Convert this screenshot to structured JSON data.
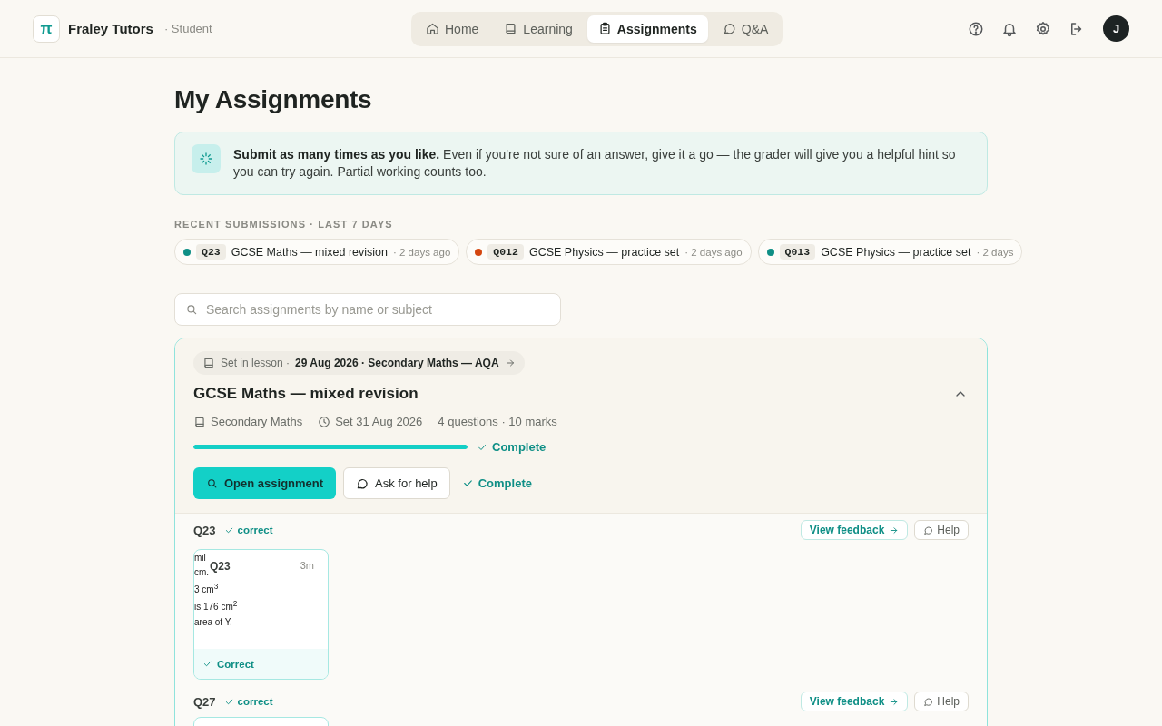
{
  "app": {
    "logo": "π",
    "name": "Fraley Tutors",
    "role": "· Student"
  },
  "nav": [
    {
      "label": "Home",
      "selected": false
    },
    {
      "label": "Learning",
      "selected": false
    },
    {
      "label": "Assignments",
      "selected": true
    },
    {
      "label": "Q&A",
      "selected": false
    }
  ],
  "header_actions": [
    {
      "kind": "help"
    },
    {
      "kind": "bell"
    },
    {
      "kind": "gear"
    },
    {
      "kind": "logout"
    }
  ],
  "avatar": "J",
  "page_title": "My Assignments",
  "banner": {
    "text": "**Submit as many times as you like.** Even if you're not sure of an answer, give it a go — the grader will give you a helpful hint so you can try again. Partial working counts too."
  },
  "recent": {
    "heading": "RECENT SUBMISSIONS · LAST 7 DAYS",
    "items": [
      {
        "code": "Q23",
        "title": "GCSE Maths — mixed revision",
        "when": "· 2 days ago",
        "color": "#0f8f86"
      },
      {
        "code": "Q012",
        "title": "GCSE Physics — practice set",
        "when": "· 2 days ago",
        "color": "#d4460f"
      },
      {
        "code": "Q013",
        "title": "GCSE Physics — practice set",
        "when": "· 2 days",
        "color": "#0f8f86"
      }
    ]
  },
  "search": {
    "placeholder": "Search assignments by name or subject"
  },
  "assignment": {
    "lesson_prefix": "Set in lesson ·",
    "lesson": "29 Aug 2026 · Secondary Maths — AQA",
    "title": "GCSE Maths — mixed revision",
    "expanded": true,
    "subject": "Secondary Maths",
    "set_date": "Set 31 Aug 2026",
    "counts": "4 questions · 10 marks",
    "level": 1,
    "progress_label": "Complete",
    "open_button": "Open assignment",
    "help_button": "Ask for help",
    "status": "Complete",
    "questions": [
      {
        "code": "Q23",
        "result": "correct",
        "feedback": "View feedback",
        "help": "Help",
        "thumb": {
          "code": "Q23",
          "time": "3m",
          "lines": [
            "mil",
            "cm.",
            "3 cm$^{3}$",
            "is 176 cm$^{2}$",
            "area of Y."
          ],
          "status": "Correct"
        }
      },
      {
        "code": "Q27",
        "result": "correct",
        "feedback": "View feedback",
        "help": "Help"
      }
    ]
  }
}
